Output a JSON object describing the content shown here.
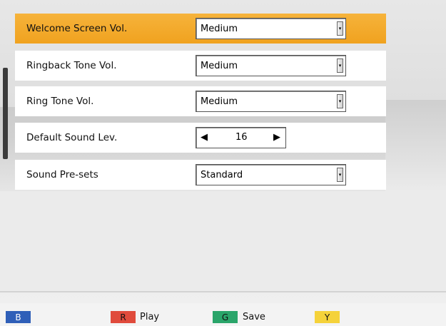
{
  "settings": [
    {
      "label": "Welcome Screen Vol.",
      "value": "Medium",
      "control": "dropdown",
      "selected": true
    },
    {
      "label": "Ringback Tone Vol.",
      "value": "Medium",
      "control": "dropdown",
      "selected": false
    },
    {
      "label": "Ring Tone Vol.",
      "value": "Medium",
      "control": "dropdown",
      "selected": false
    },
    {
      "label": "Default Sound Lev.",
      "value": "16",
      "control": "stepper",
      "selected": false
    },
    {
      "label": "Sound Pre-sets",
      "value": "Standard",
      "control": "dropdown",
      "selected": false
    }
  ],
  "footer": {
    "blue_key": "B",
    "red_key": "R",
    "red_label": "Play",
    "green_key": "G",
    "green_label": "Save",
    "yellow_key": "Y"
  },
  "icons": {
    "dropdown_arrow": "chevron-down-icon",
    "stepper_left": "left-triangle-icon",
    "stepper_right": "right-triangle-icon"
  },
  "colors": {
    "selected_row": "#f0a21f",
    "blue_key": "#2f5fb8",
    "red_key": "#e04b3c",
    "green_key": "#2aa56a",
    "yellow_key": "#f5d23a"
  }
}
